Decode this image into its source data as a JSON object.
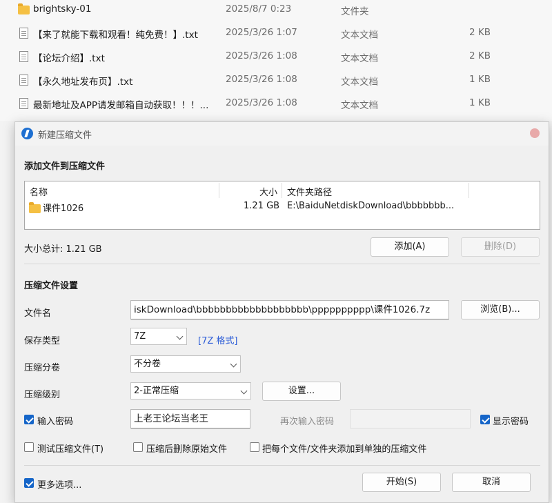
{
  "explorer": {
    "files": [
      {
        "name": "brightsky-01",
        "date": "2025/8/7 0:23",
        "type": "文件夹",
        "size": "",
        "icon": "folder-icon"
      },
      {
        "name": "【来了就能下载和观看！纯免费！】.txt",
        "date": "2025/3/26 1:07",
        "type": "文本文档",
        "size": "2 KB",
        "icon": "text-file-icon"
      },
      {
        "name": "【论坛介绍】.txt",
        "date": "2025/3/26 1:08",
        "type": "文本文档",
        "size": "2 KB",
        "icon": "text-file-icon"
      },
      {
        "name": "【永久地址发布页】.txt",
        "date": "2025/3/26 1:08",
        "type": "文本文档",
        "size": "1 KB",
        "icon": "text-file-icon"
      },
      {
        "name": "最新地址及APP请发邮箱自动获取！！！...",
        "date": "2025/3/26 1:08",
        "type": "文本文档",
        "size": "1 KB",
        "icon": "text-file-icon"
      }
    ]
  },
  "dialog": {
    "title": "新建压缩文件",
    "add_section_title": "添加文件到压缩文件",
    "list": {
      "col_name": "名称",
      "col_size": "大小",
      "col_path": "文件夹路径",
      "row": {
        "name": "课件1026",
        "size": "1.21 GB",
        "path": "E:\\BaiduNetdiskDownload\\bbbbbbb..."
      }
    },
    "total_label": "大小总计: 1.21 GB",
    "add_button": "添加(A)",
    "delete_button": "删除(D)",
    "settings_section_title": "压缩文件设置",
    "filename_label": "文件名",
    "filename_value": "iskDownload\\bbbbbbbbbbbbbbbbbbb\\pppppppppp\\课件1026.7z",
    "browse_button": "浏览(B)...",
    "save_type_label": "保存类型",
    "save_type_value": "7Z",
    "format_link": "[7Z 格式]",
    "split_label": "压缩分卷",
    "split_value": "不分卷",
    "level_label": "压缩级别",
    "level_value": "2-正常压缩",
    "settings_button": "设置...",
    "password_checkbox": "输入密码",
    "password_value": "上老王论坛当老王",
    "reenter_label": "再次输入密码",
    "show_password": "显示密码",
    "test_checkbox": "测试压缩文件(T)",
    "delete_after_checkbox": "压缩后删除原始文件",
    "separate_checkbox": "把每个文件/文件夹添加到单独的压缩文件",
    "more_options": "更多选项...",
    "start_button": "开始(S)",
    "cancel_button": "取消"
  },
  "colors": {
    "accent": "#1565c8",
    "link": "#2a5bd7",
    "folder": "#f5c043"
  }
}
